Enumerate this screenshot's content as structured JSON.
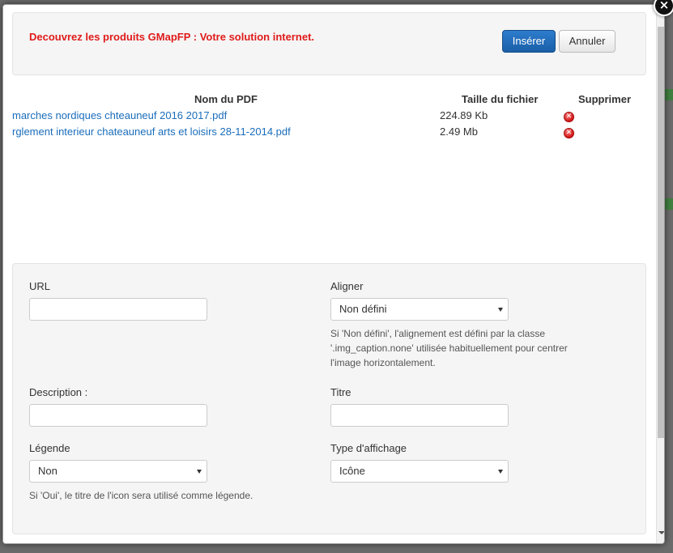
{
  "header": {
    "promo_text": "Decouvrez les produits GMapFP : Votre solution internet.",
    "insert_label": "Insérer",
    "cancel_label": "Annuler"
  },
  "close_symbol": "×",
  "files_table": {
    "columns": [
      "Nom du PDF",
      "Taille du fichier",
      "Supprimer"
    ],
    "rows": [
      {
        "name": "marches nordiques chteauneuf 2016 2017.pdf",
        "size": "224.89 Kb",
        "delete_icon": "delete-icon"
      },
      {
        "name": "rglement interieur chateauneuf arts et loisirs 28-11-2014.pdf",
        "size": "2.49 Mb",
        "delete_icon": "delete-icon"
      }
    ]
  },
  "form": {
    "url_label": "URL",
    "url_value": "",
    "align_label": "Aligner",
    "align_value": "Non défini",
    "align_help": "Si 'Non défini', l'alignement est défini par la classe '.img_caption.none' utilisée habituellement pour centrer l'image horizontalement.",
    "description_label": "Description :",
    "description_value": "",
    "title_label": "Titre",
    "title_value": "",
    "caption_label": "Légende",
    "caption_value": "Non",
    "caption_help": "Si 'Oui', le titre de l'icon sera utilisé comme légende.",
    "display_type_label": "Type d'affichage",
    "display_type_value": "Icône"
  },
  "colors": {
    "promo": "#e01b1b",
    "link": "#1a6dbb",
    "primary_button": "#1a5fa8"
  }
}
